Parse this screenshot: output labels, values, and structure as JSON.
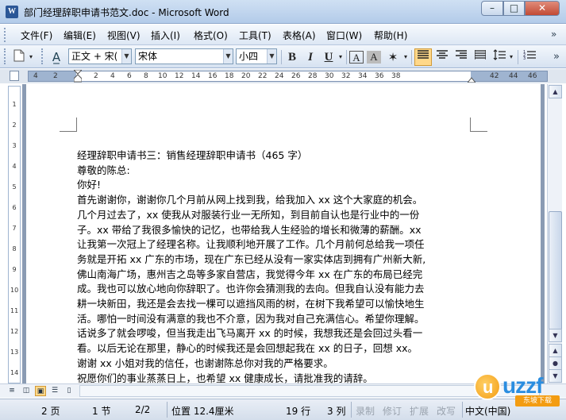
{
  "window": {
    "title": "部门经理辞职申请书范文.doc - Microsoft Word",
    "app_icon_letter": "W",
    "min_label": "–",
    "max_label": "□",
    "close_label": "✕"
  },
  "menu": {
    "items": [
      "文件(F)",
      "编辑(E)",
      "视图(V)",
      "插入(I)",
      "格式(O)",
      "工具(T)",
      "表格(A)",
      "窗口(W)",
      "帮助(H)"
    ],
    "overflow": "»"
  },
  "toolbar": {
    "style_value": "正文 + 宋(",
    "font_value": "宋体",
    "size_value": "小四",
    "bold": "B",
    "italic": "I",
    "underline": "U",
    "font_color_a": "A",
    "char_border_a": "A",
    "char_shading_a": "A"
  },
  "ruler": {
    "labels": [
      "4",
      "2",
      "2",
      "4",
      "6",
      "8",
      "10",
      "12",
      "14",
      "16",
      "18",
      "20",
      "22",
      "24",
      "26",
      "28",
      "30",
      "32",
      "34",
      "36",
      "38",
      "42",
      "44",
      "46"
    ]
  },
  "vruler": {
    "labels": [
      "1",
      "2",
      "3",
      "4",
      "5",
      "6",
      "7",
      "8",
      "9",
      "10",
      "11",
      "12",
      "13",
      "14"
    ]
  },
  "document": {
    "lines": [
      "经理辞职申请书三：销售经理辞职申请书（465 字）",
      "尊敬的陈总:",
      "你好!",
      "首先谢谢你，谢谢你几个月前从网上找到我，给我加入 xx 这个大家庭的机会。",
      "几个月过去了，xx 使我从对服装行业一无所知，到目前自认也是行业中的一份",
      "子。xx 带给了我很多愉快的记忆，也带给我人生经验的增长和微薄的薪酬。xx",
      "让我第一次冠上了经理名称。让我顺利地开展了工作。几个月前何总给我一项任",
      "务就是开拓 xx 广东的市场，现在广东已经从没有一家实体店到拥有广州新大新,",
      "佛山南海广场，惠州吉之岛等多家自营店，我觉得今年 xx 在广东的布局已经完",
      "成。我也可以放心地向你辞职了。也许你会猜测我的去向。但我自认没有能力去",
      "耕一块新田，我还是会去找一棵可以遮挡风雨的树，在树下我希望可以愉快地生",
      "活。哪怕一时间没有满意的我也不介意，因为我对自己充满信心。希望你理解。",
      "话说多了就会啰唆，但当我走出飞马离开 xx 的时候，我想我还是会回过头看一",
      "看。以后无论在那里，静心的时候我还是会回想起我在 xx 的日子，回想 xx。",
      "谢谢 xx 小姐对我的信任，也谢谢陈总你对我的严格要求。",
      "祝愿你们的事业蒸蒸日上，也希望 xx 健康成长，请批准我的请辞。"
    ]
  },
  "statusbar": {
    "page": "2 页",
    "section": "1 节",
    "page_of": "2/2",
    "position": "位置 12.4厘米",
    "line": "19 行",
    "column": "3 列",
    "rec": "录制",
    "trk": "修订",
    "ext": "扩展",
    "ovr": "改写",
    "language": "中文(中国)"
  },
  "watermark": {
    "text": "uzzf",
    "sub": "东坡下载"
  }
}
